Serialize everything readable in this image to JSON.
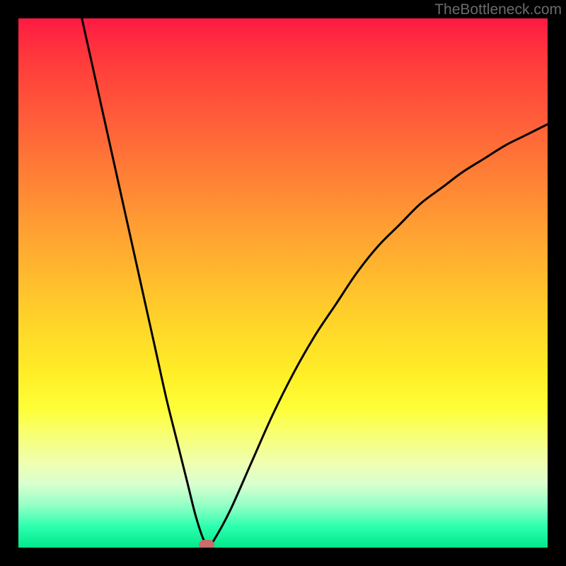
{
  "watermark": "TheBottleneck.com",
  "chart_data": {
    "type": "line",
    "title": "",
    "xlabel": "",
    "ylabel": "",
    "xlim": [
      0,
      100
    ],
    "ylim": [
      0,
      100
    ],
    "series": [
      {
        "name": "bottleneck-curve",
        "x": [
          12,
          14,
          16,
          18,
          20,
          22,
          24,
          26,
          28,
          30,
          32,
          33.5,
          35,
          36,
          37,
          40,
          44,
          48,
          52,
          56,
          60,
          64,
          68,
          72,
          76,
          80,
          84,
          88,
          92,
          96,
          100
        ],
        "values": [
          100,
          91,
          82,
          73,
          64,
          55,
          46,
          37,
          28,
          20,
          12,
          6,
          1.5,
          0.5,
          1.5,
          7,
          16,
          25,
          33,
          40,
          46,
          52,
          57,
          61,
          65,
          68,
          71,
          73.5,
          76,
          78,
          80
        ]
      }
    ],
    "marker": {
      "x": 35.5,
      "y": 0.5
    },
    "gradient_stops": [
      {
        "pct": 0,
        "color": "#ff1a44"
      },
      {
        "pct": 50,
        "color": "#ffcc2a"
      },
      {
        "pct": 80,
        "color": "#fcff55"
      },
      {
        "pct": 100,
        "color": "#00e989"
      }
    ]
  }
}
